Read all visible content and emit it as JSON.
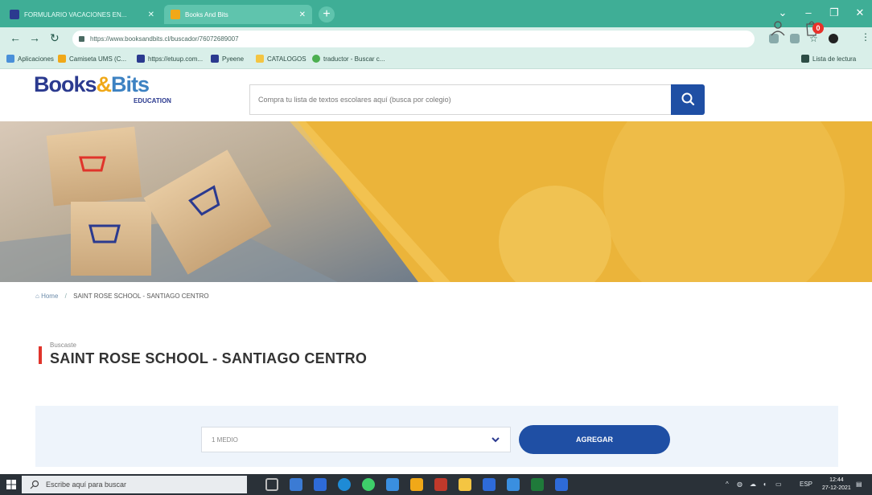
{
  "browser": {
    "tabs": [
      {
        "label": "FORMULARIO VACACIONES EN...",
        "favicon_color": "#2b3a8f"
      },
      {
        "label": "Books And Bits",
        "favicon_color": "#f0a818"
      }
    ],
    "url": "https://www.booksandbits.cl/buscador/76072689007",
    "bookmarks": [
      {
        "label": "Aplicaciones",
        "color": "#4a90d9"
      },
      {
        "label": "Camiseta UMS (C...",
        "color": "#f0a818"
      },
      {
        "label": "https://etuup.com...",
        "color": "#2b3a8f"
      },
      {
        "label": "Pyeene",
        "color": "#2b3a8f"
      },
      {
        "label": "CATALOGOS",
        "color": "#f4c542"
      },
      {
        "label": "traductor - Buscar c...",
        "color": "#4caf50"
      }
    ],
    "reading_list": "Lista de lectura"
  },
  "site": {
    "logo": {
      "part1": "Books",
      "amp": "&",
      "part2": "Bits",
      "sub": "EDUCATION"
    },
    "search_placeholder": "Compra tu lista de textos escolares aquí (busca por colegio)",
    "cart_count": "0",
    "breadcrumb": {
      "home": "Home",
      "separator": "/",
      "current": "SAINT ROSE SCHOOL - SANTIAGO CENTRO"
    },
    "searched_label": "Buscaste",
    "title": "SAINT ROSE SCHOOL - SANTIAGO CENTRO",
    "grade_select": "1 MEDIO",
    "add_button": "AGREGAR"
  },
  "taskbar": {
    "search_placeholder": "Escribe aquí para buscar",
    "language": "ESP",
    "time": "12:44",
    "date": "27-12-2021"
  },
  "colors": {
    "brand_navy": "#2b3a8f",
    "brand_blue": "#1f4fa4",
    "accent_yellow": "#ebb43a",
    "accent_red": "#e0342b"
  }
}
